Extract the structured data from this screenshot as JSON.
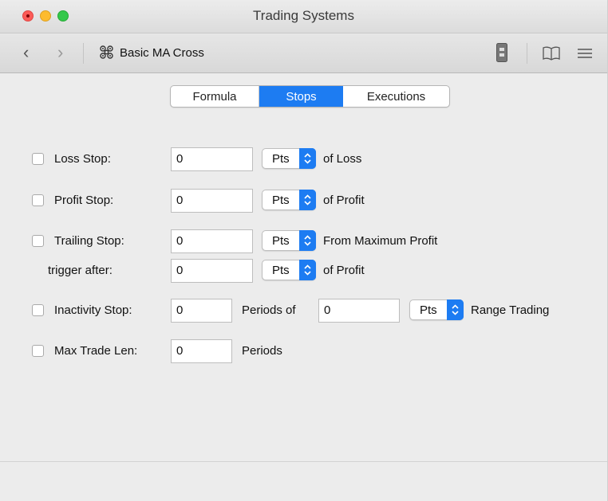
{
  "window": {
    "title": "Trading Systems"
  },
  "toolbar": {
    "system_name": "Basic MA Cross"
  },
  "tabs": [
    {
      "label": "Formula",
      "selected": false
    },
    {
      "label": "Stops",
      "selected": true
    },
    {
      "label": "Executions",
      "selected": false
    }
  ],
  "stops": {
    "loss": {
      "label": "Loss Stop:",
      "value": "0",
      "unit": "Pts",
      "suffix": "of Loss",
      "checked": false
    },
    "profit": {
      "label": "Profit Stop:",
      "value": "0",
      "unit": "Pts",
      "suffix": "of Profit",
      "checked": false
    },
    "trailing": {
      "label": "Trailing Stop:",
      "value": "0",
      "unit": "Pts",
      "suffix": "From Maximum Profit",
      "checked": false
    },
    "trigger": {
      "label": "trigger after:",
      "value": "0",
      "unit": "Pts",
      "suffix": "of Profit"
    },
    "inactivity": {
      "label": "Inactivity Stop:",
      "value": "0",
      "mid_label": "Periods of",
      "value2": "0",
      "unit": "Pts",
      "suffix": "Range Trading",
      "checked": false
    },
    "max_trade": {
      "label": "Max Trade Len:",
      "value": "0",
      "suffix": "Periods",
      "checked": false
    }
  },
  "colors": {
    "accent": "#1d7cf2"
  },
  "icons": [
    "close-traffic-light",
    "minimize-traffic-light",
    "zoom-traffic-light",
    "chevron-left-icon",
    "chevron-right-icon",
    "trading-system-icon",
    "document-icon",
    "book-icon",
    "list-icon",
    "popup-arrows-icon"
  ]
}
